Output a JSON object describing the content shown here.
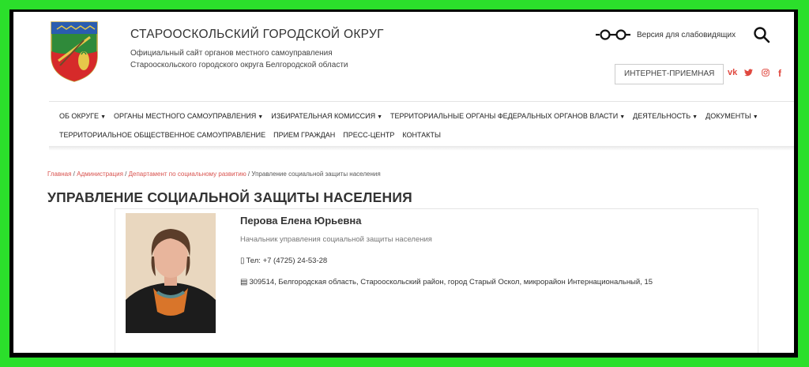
{
  "header": {
    "title": "СТАРООСКОЛЬСКИЙ ГОРОДСКОЙ ОКРУГ",
    "subtitle_line1": "Официальный сайт органов местного самоуправления",
    "subtitle_line2": "Старооскольского городского округа Белгородской области",
    "visually_impaired_label": "Версия для слабовидящих",
    "reception_button": "ИНТЕРНЕТ-ПРИЕМНАЯ",
    "social": [
      {
        "icon": "vk-icon",
        "glyph": "vk"
      },
      {
        "icon": "twitter-icon",
        "glyph": "🐦"
      },
      {
        "icon": "instagram-icon",
        "glyph": "◎"
      },
      {
        "icon": "facebook-icon",
        "glyph": "f"
      }
    ]
  },
  "nav": {
    "row1": [
      {
        "label": "ОБ ОКРУГЕ",
        "dropdown": true
      },
      {
        "label": "ОРГАНЫ МЕСТНОГО САМОУПРАВЛЕНИЯ",
        "dropdown": true
      },
      {
        "label": "ИЗБИРАТЕЛЬНАЯ КОМИССИЯ",
        "dropdown": true
      },
      {
        "label": "ТЕРРИТОРИАЛЬНЫЕ ОРГАНЫ ФЕДЕРАЛЬНЫХ ОРГАНОВ ВЛАСТИ",
        "dropdown": true
      },
      {
        "label": "ДЕЯТЕЛЬНОСТЬ",
        "dropdown": true
      },
      {
        "label": "ДОКУМЕНТЫ",
        "dropdown": true
      }
    ],
    "row2": [
      {
        "label": "ТЕРРИТОРИАЛЬНОЕ ОБЩЕСТВЕННОЕ САМОУПРАВЛЕНИЕ",
        "dropdown": false
      },
      {
        "label": "ПРИЕМ ГРАЖДАН",
        "dropdown": false
      },
      {
        "label": "ПРЕСС-ЦЕНТР",
        "dropdown": false
      },
      {
        "label": "КОНТАКТЫ",
        "dropdown": false
      }
    ]
  },
  "breadcrumb": {
    "links": [
      "Главная",
      "Администрация",
      "Департамент по социальному развитию"
    ],
    "separator": " / ",
    "current": "Управление социальной защиты населения"
  },
  "page_title": "УПРАВЛЕНИЕ СОЦИАЛЬНОЙ ЗАЩИТЫ НАСЕЛЕНИЯ",
  "person": {
    "name": "Перова Елена Юрьевна",
    "position": "Начальник управления социальной защиты населения",
    "phone": "Тел: +7 (4725) 24-53-28",
    "address": "309514, Белгородская область, Старооскольский район, город Старый Оскол, микрорайон Интернациональный, 15"
  },
  "colors": {
    "accent": "#d9534f",
    "frame_outer": "#2bdf2b",
    "frame_inner": "#000000"
  }
}
